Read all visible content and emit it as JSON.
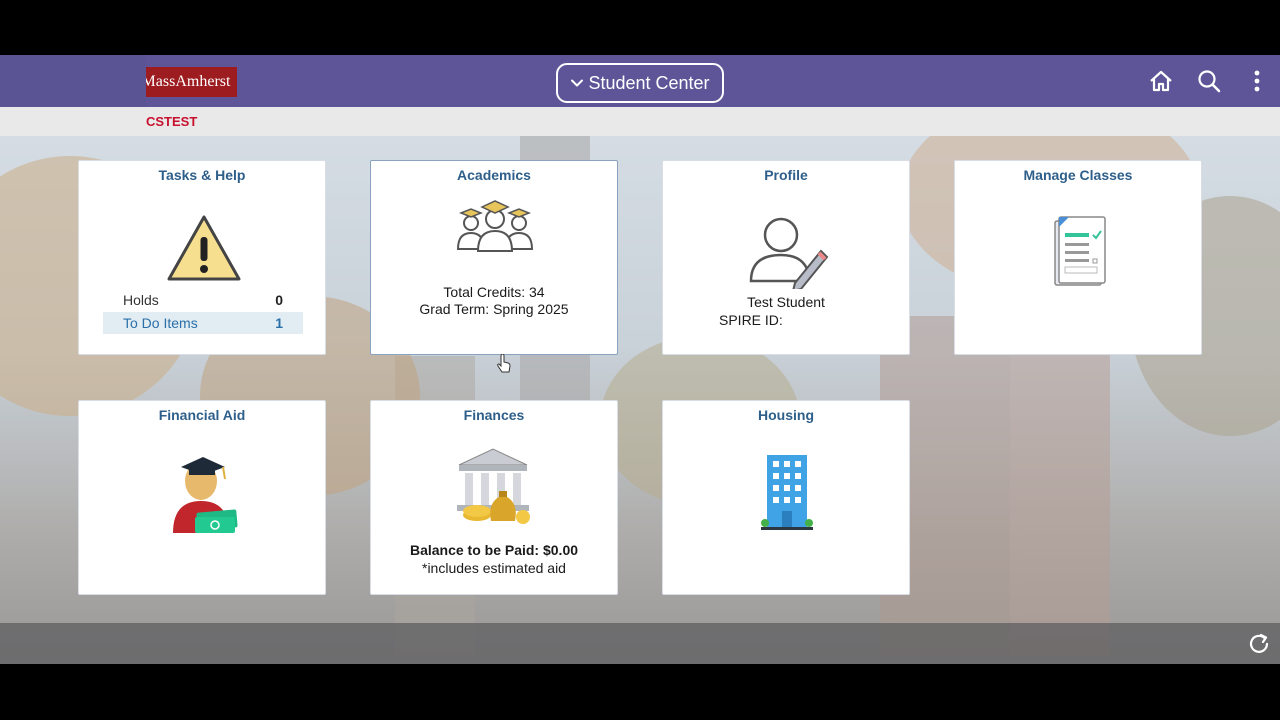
{
  "header": {
    "logo_text": "UMassAmherst",
    "center_button_label": "Student Center",
    "icons": [
      "home-icon",
      "search-icon",
      "more-vertical-icon"
    ]
  },
  "environment_label": "CSTEST",
  "tiles": {
    "tasks": {
      "title": "Tasks & Help",
      "icon": "warning-icon",
      "rows": [
        {
          "label": "Holds",
          "value": "0"
        },
        {
          "label": "To Do Items",
          "value": "1"
        }
      ]
    },
    "academics": {
      "title": "Academics",
      "icon": "graduates-icon",
      "line1": "Total Credits: 34",
      "line2": "Grad Term: Spring 2025"
    },
    "profile": {
      "title": "Profile",
      "icon": "user-edit-icon",
      "name": "Test Student",
      "id_label": "SPIRE ID:"
    },
    "manage_classes": {
      "title": "Manage Classes",
      "icon": "checklist-icon"
    },
    "financial_aid": {
      "title": "Financial Aid",
      "icon": "graduate-money-icon"
    },
    "finances": {
      "title": "Finances",
      "icon": "bank-moneybag-icon",
      "balance": "Balance to be Paid: $0.00",
      "note": "*includes estimated aid"
    },
    "housing": {
      "title": "Housing",
      "icon": "building-icon"
    }
  },
  "colors": {
    "header_bg": "#5d5597",
    "tile_title": "#2e5f8a",
    "logo_bg": "#9c1c1f",
    "env_text": "#c8102e"
  }
}
